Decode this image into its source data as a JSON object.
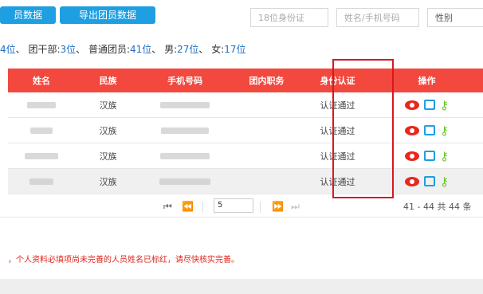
{
  "toolbar": {
    "btn1": "员数据",
    "btn2": "导出团员数据",
    "id_placeholder": "18位身份证",
    "name_placeholder": "姓名/手机号码",
    "gender_label": "性别"
  },
  "summary": {
    "p1": "4位",
    "sep1": "、 团干部:",
    "cadre": "3位",
    "sep2": "、 普通团员:",
    "members": "41位",
    "sep3": "、 男:",
    "male": "27位",
    "sep4": "、 女:",
    "female": "17位"
  },
  "table": {
    "headers": [
      "姓名",
      "民族",
      "手机号码",
      "团内职务",
      "身份认证",
      "操作"
    ],
    "rows": [
      {
        "ethnicity": "汉族",
        "status": "认证通过"
      },
      {
        "ethnicity": "汉族",
        "status": "认证通过"
      },
      {
        "ethnicity": "汉族",
        "status": "认证通过"
      },
      {
        "ethnicity": "汉族",
        "status": "认证通过"
      }
    ]
  },
  "pager": {
    "page": "5",
    "info": "41 - 44 共 44 条"
  },
  "notice": "，个人资料必填项尚未完善的人员姓名已标红，请尽快核实完善。"
}
